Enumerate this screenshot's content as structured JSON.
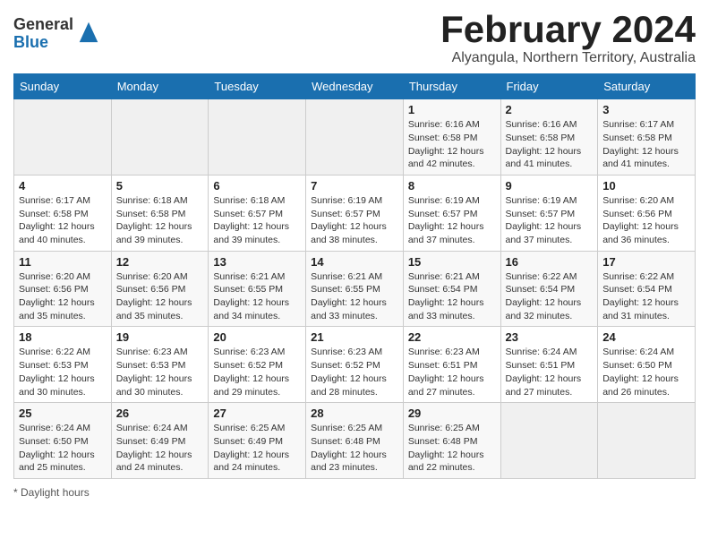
{
  "header": {
    "logo_general": "General",
    "logo_blue": "Blue",
    "month_title": "February 2024",
    "subtitle": "Alyangula, Northern Territory, Australia"
  },
  "calendar": {
    "headers": [
      "Sunday",
      "Monday",
      "Tuesday",
      "Wednesday",
      "Thursday",
      "Friday",
      "Saturday"
    ],
    "weeks": [
      [
        {
          "day": "",
          "info": ""
        },
        {
          "day": "",
          "info": ""
        },
        {
          "day": "",
          "info": ""
        },
        {
          "day": "",
          "info": ""
        },
        {
          "day": "1",
          "info": "Sunrise: 6:16 AM\nSunset: 6:58 PM\nDaylight: 12 hours and 42 minutes."
        },
        {
          "day": "2",
          "info": "Sunrise: 6:16 AM\nSunset: 6:58 PM\nDaylight: 12 hours and 41 minutes."
        },
        {
          "day": "3",
          "info": "Sunrise: 6:17 AM\nSunset: 6:58 PM\nDaylight: 12 hours and 41 minutes."
        }
      ],
      [
        {
          "day": "4",
          "info": "Sunrise: 6:17 AM\nSunset: 6:58 PM\nDaylight: 12 hours and 40 minutes."
        },
        {
          "day": "5",
          "info": "Sunrise: 6:18 AM\nSunset: 6:58 PM\nDaylight: 12 hours and 39 minutes."
        },
        {
          "day": "6",
          "info": "Sunrise: 6:18 AM\nSunset: 6:57 PM\nDaylight: 12 hours and 39 minutes."
        },
        {
          "day": "7",
          "info": "Sunrise: 6:19 AM\nSunset: 6:57 PM\nDaylight: 12 hours and 38 minutes."
        },
        {
          "day": "8",
          "info": "Sunrise: 6:19 AM\nSunset: 6:57 PM\nDaylight: 12 hours and 37 minutes."
        },
        {
          "day": "9",
          "info": "Sunrise: 6:19 AM\nSunset: 6:57 PM\nDaylight: 12 hours and 37 minutes."
        },
        {
          "day": "10",
          "info": "Sunrise: 6:20 AM\nSunset: 6:56 PM\nDaylight: 12 hours and 36 minutes."
        }
      ],
      [
        {
          "day": "11",
          "info": "Sunrise: 6:20 AM\nSunset: 6:56 PM\nDaylight: 12 hours and 35 minutes."
        },
        {
          "day": "12",
          "info": "Sunrise: 6:20 AM\nSunset: 6:56 PM\nDaylight: 12 hours and 35 minutes."
        },
        {
          "day": "13",
          "info": "Sunrise: 6:21 AM\nSunset: 6:55 PM\nDaylight: 12 hours and 34 minutes."
        },
        {
          "day": "14",
          "info": "Sunrise: 6:21 AM\nSunset: 6:55 PM\nDaylight: 12 hours and 33 minutes."
        },
        {
          "day": "15",
          "info": "Sunrise: 6:21 AM\nSunset: 6:54 PM\nDaylight: 12 hours and 33 minutes."
        },
        {
          "day": "16",
          "info": "Sunrise: 6:22 AM\nSunset: 6:54 PM\nDaylight: 12 hours and 32 minutes."
        },
        {
          "day": "17",
          "info": "Sunrise: 6:22 AM\nSunset: 6:54 PM\nDaylight: 12 hours and 31 minutes."
        }
      ],
      [
        {
          "day": "18",
          "info": "Sunrise: 6:22 AM\nSunset: 6:53 PM\nDaylight: 12 hours and 30 minutes."
        },
        {
          "day": "19",
          "info": "Sunrise: 6:23 AM\nSunset: 6:53 PM\nDaylight: 12 hours and 30 minutes."
        },
        {
          "day": "20",
          "info": "Sunrise: 6:23 AM\nSunset: 6:52 PM\nDaylight: 12 hours and 29 minutes."
        },
        {
          "day": "21",
          "info": "Sunrise: 6:23 AM\nSunset: 6:52 PM\nDaylight: 12 hours and 28 minutes."
        },
        {
          "day": "22",
          "info": "Sunrise: 6:23 AM\nSunset: 6:51 PM\nDaylight: 12 hours and 27 minutes."
        },
        {
          "day": "23",
          "info": "Sunrise: 6:24 AM\nSunset: 6:51 PM\nDaylight: 12 hours and 27 minutes."
        },
        {
          "day": "24",
          "info": "Sunrise: 6:24 AM\nSunset: 6:50 PM\nDaylight: 12 hours and 26 minutes."
        }
      ],
      [
        {
          "day": "25",
          "info": "Sunrise: 6:24 AM\nSunset: 6:50 PM\nDaylight: 12 hours and 25 minutes."
        },
        {
          "day": "26",
          "info": "Sunrise: 6:24 AM\nSunset: 6:49 PM\nDaylight: 12 hours and 24 minutes."
        },
        {
          "day": "27",
          "info": "Sunrise: 6:25 AM\nSunset: 6:49 PM\nDaylight: 12 hours and 24 minutes."
        },
        {
          "day": "28",
          "info": "Sunrise: 6:25 AM\nSunset: 6:48 PM\nDaylight: 12 hours and 23 minutes."
        },
        {
          "day": "29",
          "info": "Sunrise: 6:25 AM\nSunset: 6:48 PM\nDaylight: 12 hours and 22 minutes."
        },
        {
          "day": "",
          "info": ""
        },
        {
          "day": "",
          "info": ""
        }
      ]
    ]
  },
  "footer": {
    "note": "* Daylight hours"
  }
}
